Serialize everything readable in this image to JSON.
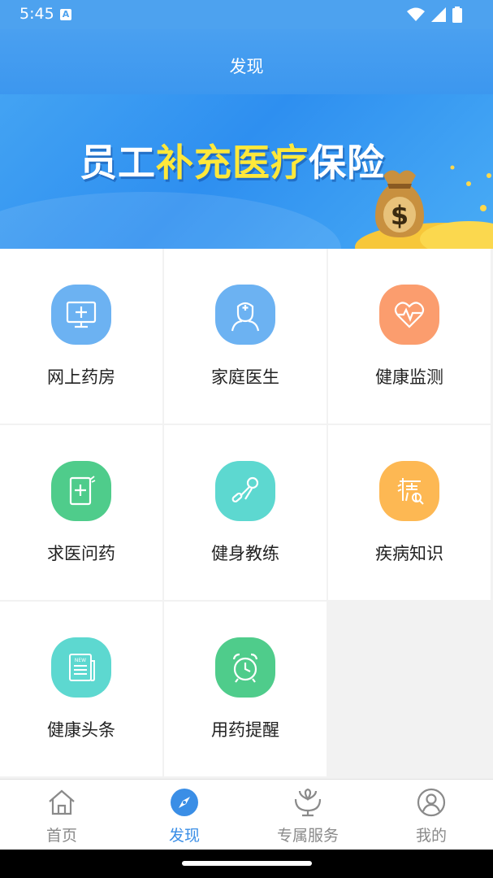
{
  "status": {
    "time": "5:45",
    "notification_letter": "A"
  },
  "header": {
    "title": "发现"
  },
  "banner": {
    "parts": [
      {
        "text": "员工",
        "color": "white"
      },
      {
        "text": "补充医疗",
        "color": "yellow"
      },
      {
        "text": "保险",
        "color": "white"
      }
    ]
  },
  "features": [
    {
      "label": "网上药房",
      "icon": "monitor-plus-icon",
      "color": "#6cb2f2"
    },
    {
      "label": "家庭医生",
      "icon": "doctor-icon",
      "color": "#6cb2f2"
    },
    {
      "label": "健康监测",
      "icon": "heart-pulse-icon",
      "color": "#fb9d6e"
    },
    {
      "label": "求医问药",
      "icon": "medical-document-icon",
      "color": "#4fcc8b"
    },
    {
      "label": "健身教练",
      "icon": "hand-grip-icon",
      "color": "#5dd8d0"
    },
    {
      "label": "疾病知识",
      "icon": "disease-search-icon",
      "color": "#fdb853"
    },
    {
      "label": "健康头条",
      "icon": "newspaper-icon",
      "color": "#5dd8d0"
    },
    {
      "label": "用药提醒",
      "icon": "alarm-clock-icon",
      "color": "#4fcc8b"
    }
  ],
  "tabs": [
    {
      "label": "首页",
      "icon": "home-icon",
      "active": false
    },
    {
      "label": "发现",
      "icon": "compass-icon",
      "active": true
    },
    {
      "label": "专属服务",
      "icon": "service-hands-icon",
      "active": false
    },
    {
      "label": "我的",
      "icon": "user-icon",
      "active": false
    }
  ],
  "colors": {
    "accent": "#3a8ee6",
    "header": "#4aa0f0",
    "banner_yellow": "#ffe83a"
  }
}
